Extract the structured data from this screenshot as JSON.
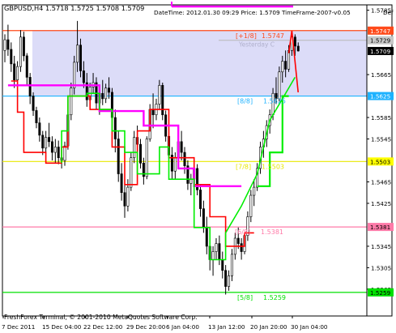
{
  "header": {
    "symbol_line": "GBPUSD,H4  1.5718 1.5725 1.5708 1.5709",
    "info_line": "DateTime: 2012.01.30 09:29   Price: 1.5709   TimeFrame-2007-v0.05",
    "def_label": "Def"
  },
  "footer": {
    "copyright": "FreshForex Terminal, © 2001-2010 MetaQuotes Software Corp."
  },
  "chart_data": {
    "type": "candlestick",
    "title": "GBPUSD,H4",
    "ylim": [
      1.5215,
      1.5795
    ],
    "y_ticks": [
      {
        "value": 1.5785,
        "label": "1.5785"
      },
      {
        "value": 1.5665,
        "label": "1.5665"
      },
      {
        "value": 1.5585,
        "label": "1.5585"
      },
      {
        "value": 1.5545,
        "label": "1.5545"
      },
      {
        "value": 1.5465,
        "label": "1.5465"
      },
      {
        "value": 1.5425,
        "label": "1.5425"
      },
      {
        "value": 1.5345,
        "label": "1.5345"
      },
      {
        "value": 1.5305,
        "label": "1.5305"
      },
      {
        "value": 1.5265,
        "label": "1.5265"
      }
    ],
    "x_ticks": [
      "7 Dec 2011",
      "15 Dec 04:00",
      "22 Dec 12:00",
      "29 Dec 20:00",
      "6 Jan 04:00",
      "13 Jan 12:00",
      "20 Jan 20:00",
      "30 Jan 04:00"
    ],
    "price_tags": [
      {
        "value": 1.5747,
        "label": "1.5747",
        "color": "#ff4a1a"
      },
      {
        "value": 1.5729,
        "label": "1.5729",
        "color": "#c8c8c8"
      },
      {
        "value": 1.5709,
        "label": "1.5709",
        "color": "#000000"
      },
      {
        "value": 1.5625,
        "label": "1.5625",
        "color": "#1eb2ff"
      },
      {
        "value": 1.5503,
        "label": "1.5503",
        "color": "#ffff00"
      },
      {
        "value": 1.5381,
        "label": "1.5381",
        "color": "#ff7aa8"
      },
      {
        "value": 1.5259,
        "label": "1.5259",
        "color": "#00e000"
      }
    ],
    "murrey_levels": [
      {
        "name": "[+1/8]",
        "value": 1.5747,
        "label": "1.5747",
        "color": "#ff4a1a"
      },
      {
        "name": "[8/8]",
        "value": 1.5625,
        "label": "1.5625",
        "color": "#1eb2ff"
      },
      {
        "name": "[7/8]",
        "value": 1.5503,
        "label": "1.5503",
        "color": "#e8e800"
      },
      {
        "name": "[6/8]",
        "value": 1.5381,
        "label": "1.5381",
        "color": "#ff7aa8"
      },
      {
        "name": "[5/8]",
        "value": 1.5259,
        "label": "1.5259",
        "color": "#00e000"
      }
    ],
    "yesterday_label": "Yesterday C",
    "zone": {
      "from": 1.5625,
      "to": 1.5747,
      "color": "#dcdcf8"
    },
    "candles": [
      [
        1.571,
        1.574,
        1.5688,
        1.573
      ],
      [
        1.573,
        1.5758,
        1.57,
        1.5712
      ],
      [
        1.5712,
        1.5725,
        1.567,
        1.5685
      ],
      [
        1.5685,
        1.57,
        1.564,
        1.5655
      ],
      [
        1.5655,
        1.569,
        1.5642,
        1.568
      ],
      [
        1.568,
        1.5748,
        1.567,
        1.5735
      ],
      [
        1.5735,
        1.5745,
        1.569,
        1.57
      ],
      [
        1.57,
        1.5705,
        1.5645,
        1.566
      ],
      [
        1.566,
        1.5668,
        1.561,
        1.5625
      ],
      [
        1.5625,
        1.5632,
        1.5588,
        1.5598
      ],
      [
        1.5598,
        1.5605,
        1.5565,
        1.5575
      ],
      [
        1.5575,
        1.5585,
        1.554,
        1.5552
      ],
      [
        1.5552,
        1.556,
        1.5515,
        1.5528
      ],
      [
        1.5528,
        1.556,
        1.5518,
        1.5548
      ],
      [
        1.5548,
        1.5575,
        1.553,
        1.554
      ],
      [
        1.554,
        1.555,
        1.5505,
        1.552
      ],
      [
        1.552,
        1.5545,
        1.55,
        1.553
      ],
      [
        1.553,
        1.5542,
        1.5498,
        1.551
      ],
      [
        1.551,
        1.5522,
        1.549,
        1.5505
      ],
      [
        1.5505,
        1.554,
        1.5495,
        1.5532
      ],
      [
        1.5532,
        1.56,
        1.5525,
        1.559
      ],
      [
        1.559,
        1.565,
        1.558,
        1.564
      ],
      [
        1.564,
        1.57,
        1.5628,
        1.5688
      ],
      [
        1.5688,
        1.5765,
        1.567,
        1.572
      ],
      [
        1.572,
        1.5732,
        1.566,
        1.5672
      ],
      [
        1.5672,
        1.569,
        1.564,
        1.565
      ],
      [
        1.565,
        1.5668,
        1.5605,
        1.5618
      ],
      [
        1.5618,
        1.565,
        1.56,
        1.5642
      ],
      [
        1.5642,
        1.5668,
        1.563,
        1.565
      ],
      [
        1.565,
        1.566,
        1.56,
        1.5612
      ],
      [
        1.5612,
        1.564,
        1.559,
        1.563
      ],
      [
        1.563,
        1.5655,
        1.5608,
        1.562
      ],
      [
        1.562,
        1.5648,
        1.5612,
        1.564
      ],
      [
        1.564,
        1.566,
        1.562,
        1.5632
      ],
      [
        1.5632,
        1.564,
        1.557,
        1.5585
      ],
      [
        1.5585,
        1.56,
        1.552,
        1.5545
      ],
      [
        1.5545,
        1.556,
        1.5465,
        1.548
      ],
      [
        1.548,
        1.55,
        1.543,
        1.5445
      ],
      [
        1.5445,
        1.546,
        1.5398,
        1.542
      ],
      [
        1.542,
        1.547,
        1.541,
        1.5455
      ],
      [
        1.5455,
        1.552,
        1.5448,
        1.551
      ],
      [
        1.551,
        1.556,
        1.55,
        1.5548
      ],
      [
        1.5548,
        1.557,
        1.552,
        1.5535
      ],
      [
        1.5535,
        1.5545,
        1.549,
        1.55
      ],
      [
        1.55,
        1.551,
        1.546,
        1.5475
      ],
      [
        1.5475,
        1.555,
        1.547,
        1.5545
      ],
      [
        1.5545,
        1.561,
        1.554,
        1.56
      ],
      [
        1.56,
        1.563,
        1.5565,
        1.559
      ],
      [
        1.559,
        1.562,
        1.558,
        1.561
      ],
      [
        1.561,
        1.5655,
        1.56,
        1.5645
      ],
      [
        1.5645,
        1.565,
        1.558,
        1.559
      ],
      [
        1.559,
        1.5598,
        1.554,
        1.555
      ],
      [
        1.555,
        1.5565,
        1.55,
        1.5515
      ],
      [
        1.5515,
        1.553,
        1.547,
        1.5485
      ],
      [
        1.5485,
        1.552,
        1.547,
        1.551
      ],
      [
        1.551,
        1.555,
        1.549,
        1.554
      ],
      [
        1.554,
        1.556,
        1.5505,
        1.552
      ],
      [
        1.552,
        1.553,
        1.548,
        1.5495
      ],
      [
        1.5495,
        1.5505,
        1.545,
        1.5462
      ],
      [
        1.5462,
        1.548,
        1.544,
        1.547
      ],
      [
        1.547,
        1.55,
        1.5455,
        1.549
      ],
      [
        1.549,
        1.5498,
        1.544,
        1.545
      ],
      [
        1.545,
        1.546,
        1.54,
        1.5415
      ],
      [
        1.5415,
        1.543,
        1.537,
        1.538
      ],
      [
        1.538,
        1.54,
        1.533,
        1.5345
      ],
      [
        1.5345,
        1.536,
        1.53,
        1.532
      ],
      [
        1.532,
        1.5345,
        1.529,
        1.5335
      ],
      [
        1.5335,
        1.536,
        1.532,
        1.535
      ],
      [
        1.535,
        1.5365,
        1.531,
        1.532
      ],
      [
        1.532,
        1.5335,
        1.5285,
        1.53
      ],
      [
        1.53,
        1.531,
        1.5255,
        1.527
      ],
      [
        1.527,
        1.53,
        1.5262,
        1.529
      ],
      [
        1.529,
        1.534,
        1.528,
        1.533
      ],
      [
        1.533,
        1.537,
        1.532,
        1.536
      ],
      [
        1.536,
        1.538,
        1.534,
        1.535
      ],
      [
        1.535,
        1.536,
        1.532,
        1.5335
      ],
      [
        1.5335,
        1.537,
        1.533,
        1.5365
      ],
      [
        1.5365,
        1.541,
        1.5355,
        1.54
      ],
      [
        1.54,
        1.545,
        1.539,
        1.544
      ],
      [
        1.544,
        1.547,
        1.542,
        1.5455
      ],
      [
        1.5455,
        1.55,
        1.5448,
        1.549
      ],
      [
        1.549,
        1.554,
        1.548,
        1.553
      ],
      [
        1.553,
        1.556,
        1.551,
        1.5545
      ],
      [
        1.5545,
        1.558,
        1.553,
        1.557
      ],
      [
        1.557,
        1.56,
        1.5555,
        1.559
      ],
      [
        1.559,
        1.564,
        1.558,
        1.563
      ],
      [
        1.563,
        1.566,
        1.561,
        1.562
      ],
      [
        1.562,
        1.568,
        1.5615,
        1.567
      ],
      [
        1.567,
        1.57,
        1.565,
        1.569
      ],
      [
        1.569,
        1.571,
        1.566,
        1.5675
      ],
      [
        1.5675,
        1.572,
        1.567,
        1.571
      ],
      [
        1.571,
        1.5745,
        1.57,
        1.5735
      ],
      [
        1.5735,
        1.574,
        1.57,
        1.5718
      ],
      [
        1.5718,
        1.5725,
        1.5708,
        1.5709
      ]
    ],
    "overlays": [
      {
        "name": "red",
        "color": "#ff0000",
        "width": 1.6,
        "points": [
          [
            2,
            1.5653
          ],
          [
            4,
            1.5653
          ],
          [
            4,
            1.5595
          ],
          [
            6,
            1.5595
          ],
          [
            6,
            1.552
          ],
          [
            13,
            1.552
          ],
          [
            13,
            1.55
          ],
          [
            18,
            1.55
          ],
          [
            18,
            1.553
          ],
          [
            20,
            1.553
          ],
          [
            20,
            1.5625
          ],
          [
            27,
            1.5625
          ],
          [
            27,
            1.56
          ],
          [
            34,
            1.56
          ],
          [
            34,
            1.553
          ],
          [
            38,
            1.553
          ],
          [
            38,
            1.546
          ],
          [
            42,
            1.546
          ],
          [
            42,
            1.556
          ],
          [
            46,
            1.556
          ],
          [
            46,
            1.56
          ],
          [
            52,
            1.56
          ],
          [
            52,
            1.551
          ],
          [
            60,
            1.551
          ],
          [
            60,
            1.546
          ],
          [
            65,
            1.546
          ],
          [
            65,
            1.54
          ],
          [
            70,
            1.54
          ],
          [
            70,
            1.5345
          ],
          [
            76,
            1.5345
          ],
          [
            76,
            1.537
          ],
          [
            79,
            1.537
          ]
        ]
      },
      {
        "name": "magenta",
        "color": "#ff00ff",
        "width": 2.4,
        "points": [
          [
            1,
            1.5645
          ],
          [
            30,
            1.5645
          ],
          [
            30,
            1.5597
          ],
          [
            44,
            1.5597
          ],
          [
            44,
            1.557
          ],
          [
            55,
            1.557
          ],
          [
            55,
            1.549
          ],
          [
            60,
            1.549
          ],
          [
            60,
            1.5457
          ],
          [
            75,
            1.5457
          ]
        ]
      },
      {
        "name": "green",
        "color": "#00ee00",
        "width": 1.6,
        "points": [
          [
            18,
            1.55
          ],
          [
            18,
            1.556
          ],
          [
            20,
            1.556
          ],
          [
            20,
            1.5625
          ],
          [
            26,
            1.5625
          ],
          [
            26,
            1.563
          ],
          [
            30,
            1.563
          ],
          [
            30,
            1.56
          ],
          [
            34,
            1.56
          ],
          [
            34,
            1.556
          ],
          [
            38,
            1.556
          ],
          [
            38,
            1.552
          ],
          [
            42,
            1.552
          ],
          [
            42,
            1.548
          ],
          [
            49,
            1.548
          ],
          [
            49,
            1.553
          ],
          [
            52,
            1.553
          ],
          [
            52,
            1.547
          ],
          [
            60,
            1.547
          ],
          [
            60,
            1.538
          ],
          [
            65,
            1.538
          ],
          [
            65,
            1.532
          ],
          [
            70,
            1.532
          ],
          [
            70,
            1.537
          ],
          [
            75,
            1.542
          ],
          [
            80,
            1.548
          ],
          [
            84,
            1.558
          ],
          [
            88,
            1.562
          ],
          [
            92,
            1.566
          ]
        ]
      },
      {
        "name": "green-step",
        "color": "#00ee00",
        "width": 2.2,
        "points": [
          [
            80,
            1.5457
          ],
          [
            84,
            1.5457
          ],
          [
            84,
            1.552
          ],
          [
            88,
            1.552
          ],
          [
            88,
            1.5625
          ],
          [
            90,
            1.5625
          ]
        ]
      },
      {
        "name": "forecast",
        "color": "#ff0000",
        "width": 1.6,
        "points": [
          [
            90,
            1.5705
          ],
          [
            91,
            1.5747
          ],
          [
            93,
            1.5632
          ]
        ]
      }
    ]
  }
}
